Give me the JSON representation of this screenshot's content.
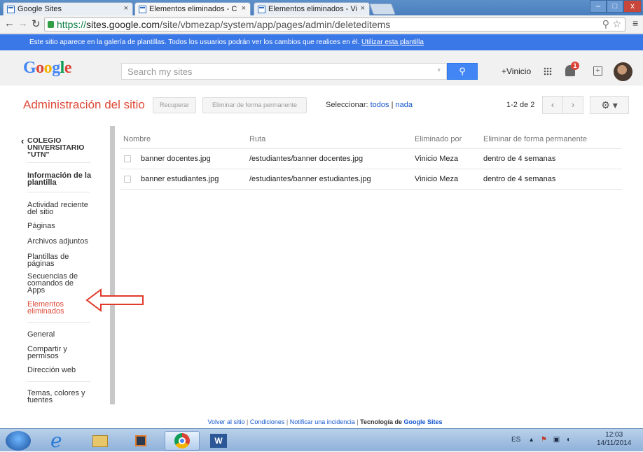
{
  "browser": {
    "tabs": [
      {
        "title": "Google Sites",
        "close": "×"
      },
      {
        "title": "Elementos eliminados - C",
        "close": "×"
      },
      {
        "title": "Elementos eliminados - Vi",
        "close": "×"
      }
    ],
    "window_controls": [
      "–",
      "□",
      "x"
    ],
    "url_https": "https://",
    "url_host": "sites.google.com",
    "url_path": "/site/vbmezap/system/app/pages/admin/deleteditems"
  },
  "banner": {
    "text": "Este sitio aparece en la galería de plantillas. Todos los usuarios podrán ver los cambios que realices en él.",
    "link": "Utilizar esta plantilla"
  },
  "header": {
    "logo": "Google",
    "search_placeholder": "Search my sites",
    "user_link": "+Vinicio",
    "notification_count": "1"
  },
  "toolbar": {
    "title": "Administración del sitio",
    "recover_label": "Recuperar",
    "delete_label": "Eliminar de forma permanente",
    "select_label": "Seleccionar:",
    "select_all": "todos",
    "select_sep": "|",
    "select_none": "nada",
    "page_count": "1-2 de 2",
    "prev": "‹",
    "next": "›",
    "gear": "⚙ ▾"
  },
  "sidebar": {
    "site_name": "COLEGIO UNIVERSITARIO \"UTN\"",
    "items": [
      "Información de la plantilla",
      "Actividad reciente del sitio",
      "Páginas",
      "Archivos adjuntos",
      "Plantillas de páginas",
      "Secuencias de comandos de Apps",
      "Elementos eliminados",
      "General",
      "Compartir y permisos",
      "Dirección web",
      "Temas, colores y fuentes"
    ]
  },
  "table": {
    "headers": [
      "Nombre",
      "Ruta",
      "Eliminado por",
      "Eliminar de forma permanente"
    ],
    "rows": [
      [
        "banner docentes.jpg",
        "/estudiantes/banner docentes.jpg",
        "Vinicio Meza",
        "dentro de 4 semanas"
      ],
      [
        "banner estudiantes.jpg",
        "/estudiantes/banner estudiantes.jpg",
        "Vinicio Meza",
        "dentro de 4 semanas"
      ]
    ]
  },
  "footer": {
    "back": "Volver al sitio",
    "terms": "Condiciones",
    "report": "Notificar una incidencia",
    "powered": "Tecnología de",
    "brand": "Google Sites"
  },
  "taskbar": {
    "lang": "ES",
    "time": "12:03",
    "date": "14/11/2014"
  },
  "colors": {
    "accent_red": "#dd4b39",
    "banner_blue": "#3b78e7",
    "link_blue": "#1155cc",
    "google_blue": "#4285f4"
  }
}
